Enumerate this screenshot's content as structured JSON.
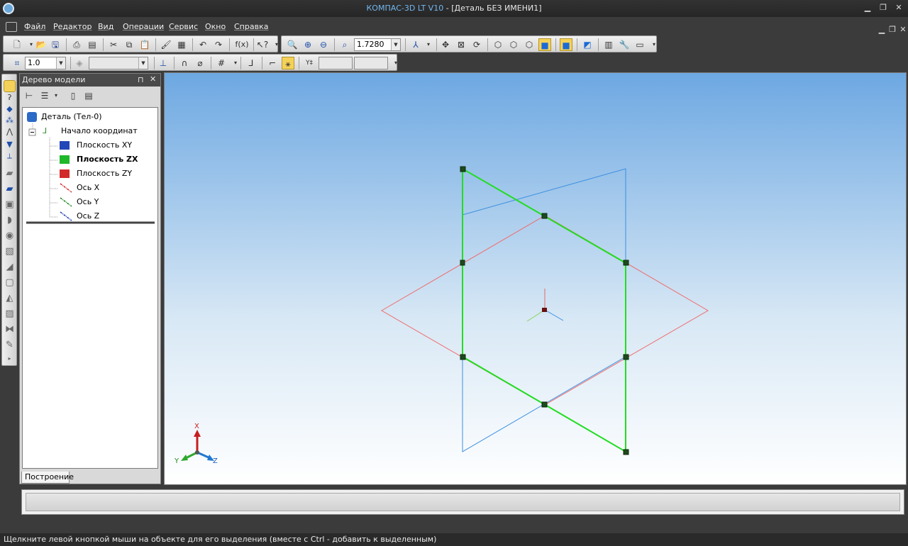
{
  "window": {
    "app_name": "КОМПАС-3D LT V10",
    "separator": " - ",
    "doc_title": "[Деталь БЕЗ ИМЕНИ1]"
  },
  "menu": [
    "Файл",
    "Редактор",
    "Вид",
    "Операции",
    "Сервис",
    "Окно",
    "Справка"
  ],
  "toolbar": {
    "zoom_value": "1.7280",
    "fx_label": "f(x)",
    "step_value": "1.0"
  },
  "model_tree": {
    "title": "Дерево модели",
    "root": "Деталь (Тел-0)",
    "origin": "Начало координат",
    "items": [
      "Плоскость XY",
      "Плоскость ZX",
      "Плоскость ZY",
      "Ось X",
      "Ось Y",
      "Ось Z"
    ],
    "tab": "Построение"
  },
  "triad": {
    "x": "X",
    "y": "Y",
    "z": "Z"
  },
  "status_text": "Щелкните левой кнопкой мыши на объекте для его выделения (вместе с Ctrl - добавить к выделенным)",
  "colors": {
    "plane_xy": "#3b8fe0",
    "plane_zx": "#22dd22",
    "plane_zy": "#f06a6a",
    "title_accent": "#73b7f0"
  }
}
